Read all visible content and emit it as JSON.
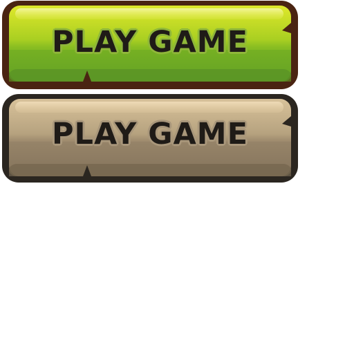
{
  "buttons": [
    {
      "label": "PLAY GAME",
      "state": "active",
      "fill_top": "#dbe526",
      "fill_bottom": "#5f9c25",
      "border": "#4a2412"
    },
    {
      "label": "PLAY GAME",
      "state": "disabled",
      "fill_top": "#d4bd94",
      "fill_bottom": "#7d6d58",
      "border": "#2b2620"
    }
  ]
}
